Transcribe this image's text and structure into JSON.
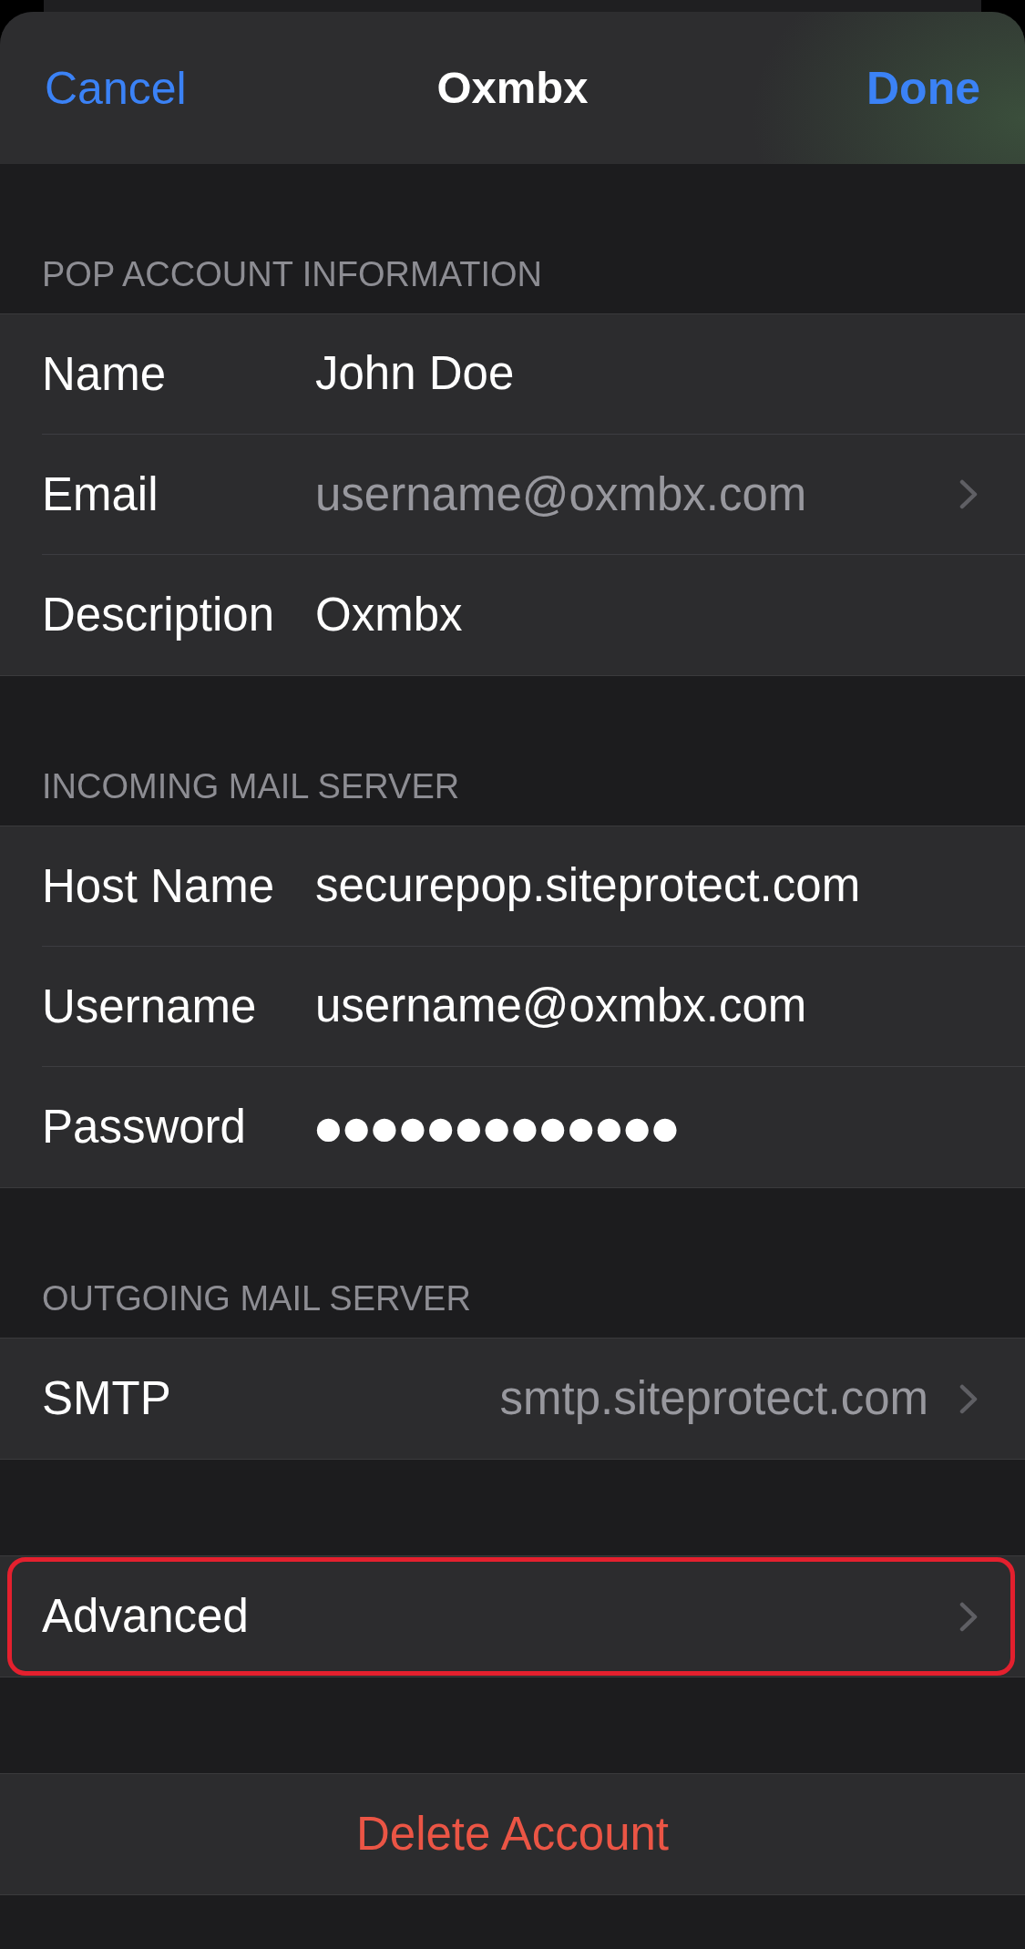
{
  "nav": {
    "cancel": "Cancel",
    "title": "Oxmbx",
    "done": "Done"
  },
  "groups": [
    {
      "header": "POP ACCOUNT INFORMATION",
      "rows": [
        {
          "kind": "text",
          "label": "Name",
          "value": "John Doe"
        },
        {
          "kind": "picker",
          "label": "Email",
          "value": "username@oxmbx.com"
        },
        {
          "kind": "text",
          "label": "Description",
          "value": "Oxmbx"
        }
      ]
    },
    {
      "header": "INCOMING MAIL SERVER",
      "rows": [
        {
          "kind": "text",
          "label": "Host Name",
          "value": "securepop.siteprotect.com"
        },
        {
          "kind": "text",
          "label": "Username",
          "value": "username@oxmbx.com"
        },
        {
          "kind": "secure",
          "label": "Password",
          "value": "●●●●●●●●●●●●●"
        }
      ]
    },
    {
      "header": "OUTGOING MAIL SERVER",
      "rows": [
        {
          "kind": "detail",
          "label": "SMTP",
          "value": "smtp.siteprotect.com"
        }
      ]
    },
    {
      "rows": [
        {
          "kind": "link",
          "label": "Advanced",
          "highlighted": true
        }
      ]
    },
    {
      "rows": [
        {
          "kind": "destructive",
          "label": "Delete Account"
        }
      ]
    }
  ]
}
